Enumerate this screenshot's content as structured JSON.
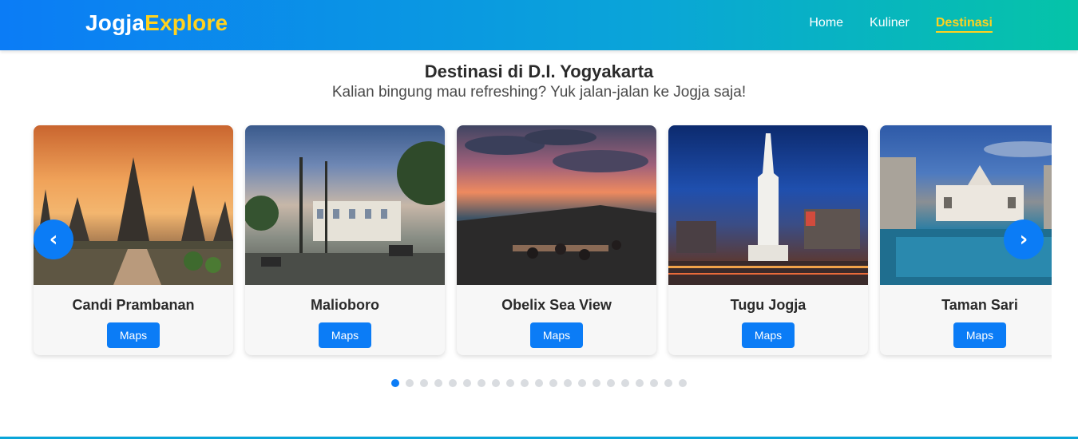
{
  "brand": {
    "part1": "Jogja",
    "part2": "Explore"
  },
  "nav": {
    "home": "Home",
    "kuliner": "Kuliner",
    "destinasi": "Destinasi",
    "active": "Destinasi"
  },
  "section": {
    "title": "Destinasi di D.I. Yogyakarta",
    "subtitle": "Kalian bingung mau refreshing? Yuk jalan-jalan ke Jogja saja!"
  },
  "cards": [
    {
      "title": "Candi Prambanan",
      "button": "Maps"
    },
    {
      "title": "Malioboro",
      "button": "Maps"
    },
    {
      "title": "Obelix Sea View",
      "button": "Maps"
    },
    {
      "title": "Tugu Jogja",
      "button": "Maps"
    },
    {
      "title": "Taman Sari",
      "button": "Maps"
    }
  ],
  "carousel": {
    "prev_icon": "‹",
    "next_icon": "›",
    "dot_count": 21,
    "active_dot": 1
  },
  "colors": {
    "accent": "#0b7cf6",
    "highlight": "#ffd21f",
    "gradient_end": "#05c4a8"
  }
}
